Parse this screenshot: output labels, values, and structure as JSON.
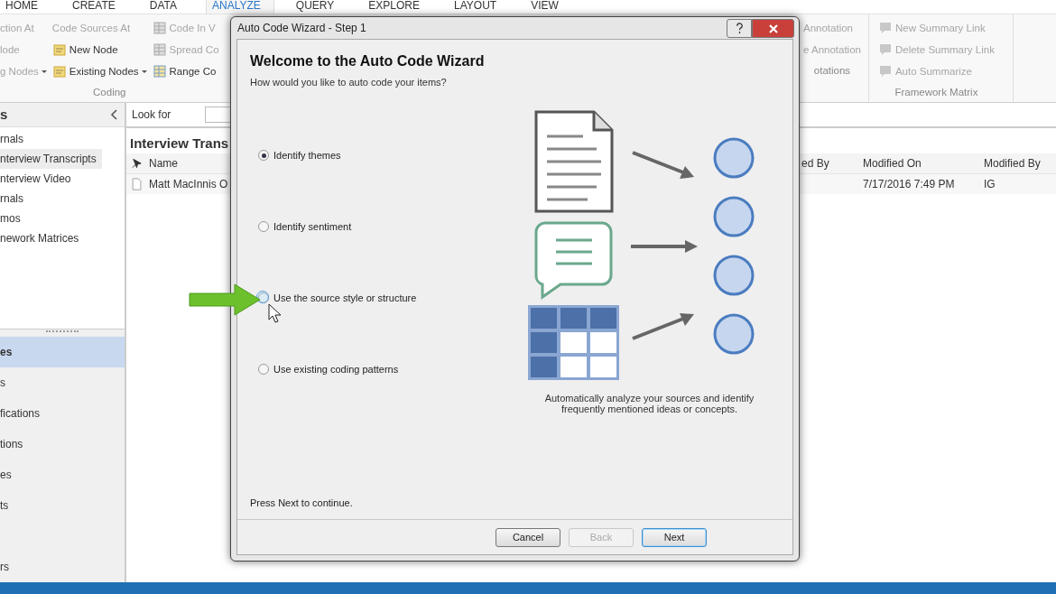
{
  "ribbon": {
    "tabs": [
      {
        "label": "HOME",
        "selected": false
      },
      {
        "label": "CREATE",
        "selected": false
      },
      {
        "label": "DATA",
        "selected": false
      },
      {
        "label": "ANALYZE",
        "selected": true
      },
      {
        "label": "QUERY",
        "selected": false
      },
      {
        "label": "EXPLORE",
        "selected": false
      },
      {
        "label": "LAYOUT",
        "selected": false
      },
      {
        "label": "VIEW",
        "selected": false
      }
    ],
    "left_groups": [
      {
        "label": "Coding",
        "columns": [
          {
            "items": [
              {
                "label": "ction At",
                "kind": "text",
                "disabled": true,
                "dropdown": false
              },
              {
                "label": "lode",
                "kind": "text",
                "disabled": true,
                "dropdown": false
              },
              {
                "label": "g Nodes",
                "kind": "text",
                "disabled": true,
                "dropdown": true
              }
            ]
          },
          {
            "items": [
              {
                "label": "Code Sources At",
                "kind": "text",
                "disabled": true,
                "dropdown": false
              },
              {
                "label": "New Node",
                "kind": "note",
                "disabled": false,
                "dropdown": false
              },
              {
                "label": "Existing Nodes",
                "kind": "note",
                "disabled": false,
                "dropdown": true
              }
            ]
          },
          {
            "items": [
              {
                "label": "Code In V",
                "kind": "sheet",
                "disabled": true,
                "dropdown": false
              },
              {
                "label": "Spread Co",
                "kind": "sheet",
                "disabled": true,
                "dropdown": false
              },
              {
                "label": "Range Co",
                "kind": "sheet",
                "disabled": false,
                "dropdown": false
              }
            ]
          }
        ]
      }
    ],
    "right_groups": [
      {
        "label": "otations",
        "columns": [
          {
            "items": [
              {
                "label": "Annotation",
                "kind": "text",
                "disabled": true,
                "dropdown": false
              },
              {
                "label": "e Annotation",
                "kind": "text",
                "disabled": true,
                "dropdown": false
              }
            ]
          }
        ]
      },
      {
        "label": "Framework Matrix",
        "columns": [
          {
            "items": [
              {
                "label": "New Summary Link",
                "kind": "comment",
                "disabled": true,
                "dropdown": false
              },
              {
                "label": "Delete Summary Link",
                "kind": "comment",
                "disabled": true,
                "dropdown": false
              },
              {
                "label": "Auto Summarize",
                "kind": "comment",
                "disabled": true,
                "dropdown": false
              }
            ]
          }
        ]
      }
    ]
  },
  "nav": {
    "header": "s",
    "folders": [
      {
        "label": "rnals",
        "selected": false
      },
      {
        "label": "nterview Transcripts",
        "selected": true
      },
      {
        "label": "nterview Video",
        "selected": false
      },
      {
        "label": "rnals",
        "selected": false
      },
      {
        "label": "mos",
        "selected": false
      },
      {
        "label": "nework Matrices",
        "selected": false
      }
    ],
    "buttons": [
      {
        "label": "es",
        "selected": true
      },
      {
        "label": "s",
        "selected": false
      },
      {
        "label": "fications",
        "selected": false
      },
      {
        "label": "tions",
        "selected": false
      },
      {
        "label": "es",
        "selected": false
      },
      {
        "label": "ts",
        "selected": false
      },
      {
        "label": "rs",
        "selected": false
      }
    ]
  },
  "find_bar": {
    "label": "Look for"
  },
  "list": {
    "title": "Interview Trans",
    "columns": {
      "name": "Name",
      "created_by": "ed By",
      "modified_on": "Modified On",
      "modified_by": "Modified By"
    },
    "rows": [
      {
        "name": "Matt MacInnis O",
        "modified_on": "7/17/2016 7:49 PM",
        "modified_by": "IG"
      }
    ]
  },
  "dialog": {
    "title": "Auto Code Wizard - Step 1",
    "heading": "Welcome to the Auto Code Wizard",
    "prompt": "How would you like to auto code your items?",
    "options": [
      {
        "label": "Identify themes",
        "selected": true,
        "hovered": false
      },
      {
        "label": "Identify sentiment",
        "selected": false,
        "hovered": false
      },
      {
        "label": "Use the source style or structure",
        "selected": false,
        "hovered": true
      },
      {
        "label": "Use existing coding patterns",
        "selected": false,
        "hovered": false
      }
    ],
    "description_lines": [
      "Automatically analyze your sources and identify",
      "frequently mentioned ideas or concepts."
    ],
    "footer_note": "Press Next to continue.",
    "buttons": [
      {
        "label": "Cancel",
        "disabled": false,
        "default": false
      },
      {
        "label": "Back",
        "disabled": true,
        "default": false
      },
      {
        "label": "Next",
        "disabled": false,
        "default": true
      }
    ]
  }
}
